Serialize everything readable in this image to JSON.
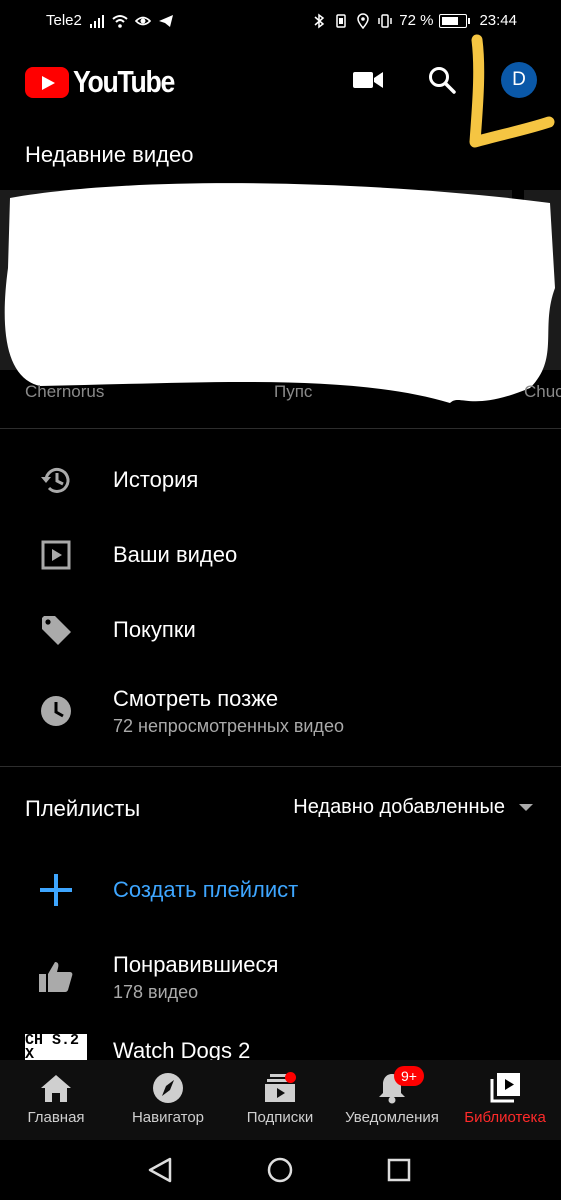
{
  "status_bar": {
    "carrier": "Tele2",
    "battery_percent": "72 %",
    "time": "23:44",
    "icons_left": [
      "signal-icon",
      "wifi-icon",
      "eye-icon",
      "telegram-icon"
    ],
    "icons_right": [
      "bluetooth-icon",
      "location-icon",
      "vibrate-icon",
      "battery-icon"
    ]
  },
  "app_bar": {
    "logo_text": "YouTube",
    "avatar_letter": "D",
    "avatar_color": "#0a58a8"
  },
  "recent": {
    "title": "Недавние видео",
    "channels": [
      "Chernorus",
      "Пупс",
      "Chuc"
    ]
  },
  "library_menu": [
    {
      "label": "История",
      "icon": "history-icon"
    },
    {
      "label": "Ваши видео",
      "icon": "your-videos-icon"
    },
    {
      "label": "Покупки",
      "icon": "tag-icon"
    },
    {
      "label": "Смотреть позже",
      "sub": "72 непросмотренных видео",
      "icon": "clock-icon"
    }
  ],
  "playlists": {
    "title": "Плейлисты",
    "sort_label": "Недавно добавленные",
    "create_label": "Создать плейлист",
    "items": [
      {
        "label": "Понравившиеся",
        "sub": "178 видео",
        "icon": "thumbs-up-icon"
      },
      {
        "label": "Watch Dogs 2",
        "thumb_text": "CH S.2 X"
      }
    ]
  },
  "bottom_nav": {
    "items": [
      {
        "label": "Главная",
        "icon": "home-icon"
      },
      {
        "label": "Навигатор",
        "icon": "compass-icon"
      },
      {
        "label": "Подписки",
        "icon": "subscriptions-icon"
      },
      {
        "label": "Уведомления",
        "icon": "bell-icon",
        "badge": "9+"
      },
      {
        "label": "Библиотека",
        "icon": "library-icon",
        "active": true
      }
    ]
  },
  "colors": {
    "background": "#000000",
    "accent_red": "#ff0000",
    "link_blue": "#3ea6ff",
    "annotation_yellow": "#f5c542"
  }
}
